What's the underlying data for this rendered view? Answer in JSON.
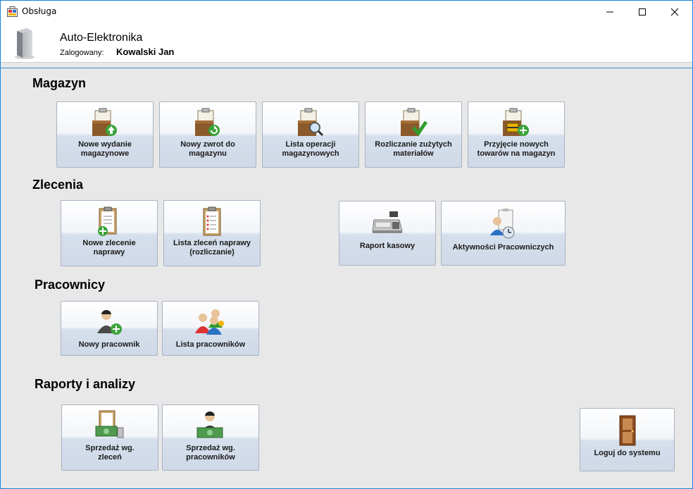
{
  "window": {
    "title": "Obsługa"
  },
  "header": {
    "company": "Auto-Elektronika",
    "login_label": "Zalogowany:",
    "login_user": "Kowalski Jan"
  },
  "sections": {
    "magazyn": "Magazyn",
    "zlecenia": "Zlecenia",
    "pracownicy": "Pracownicy",
    "raporty": "Raporty i analizy"
  },
  "tiles": {
    "nowe_wydanie": "Nowe wydanie\nmagazynowe",
    "nowy_zwrot": "Nowy zwrot do\nmagazynu",
    "lista_operacji": "Lista operacji\nmagazynowych",
    "rozliczanie": "Rozliczanie zużytych\nmateriałów",
    "przyjecie": "Przyjęcie nowych\ntowarów na magazyn",
    "nowe_zlecenie": "Nowe zlecenie\nnaprawy",
    "lista_zlecen": "Lista zleceń naprawy\n(rozliczanie)",
    "raport_kasowy": "Raport kasowy",
    "aktywnosci": "Aktywności Pracowniczych",
    "nowy_pracownik": "Nowy pracownik",
    "lista_pracownikow": "Lista pracowników",
    "sprzedaz_zlecen": "Sprzedaż wg.\nzleceń",
    "sprzedaz_pracownikow": "Sprzedaż wg.\npracowników",
    "loguj": "Loguj do systemu"
  }
}
